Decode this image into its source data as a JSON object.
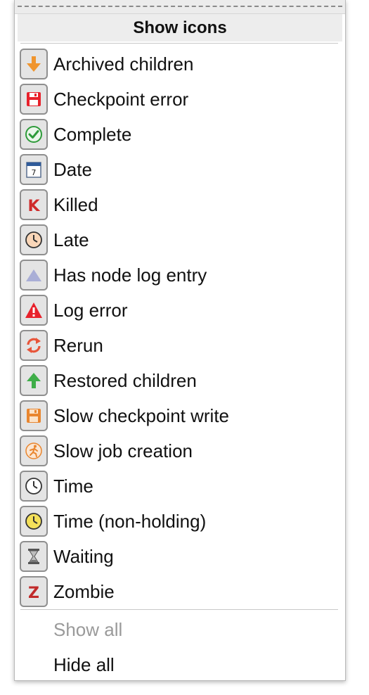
{
  "menu": {
    "header": "Show icons",
    "items": [
      {
        "label": "Archived children",
        "icon": "arrow-down-icon"
      },
      {
        "label": "Checkpoint error",
        "icon": "floppy-error-icon"
      },
      {
        "label": "Complete",
        "icon": "check-circle-icon"
      },
      {
        "label": "Date",
        "icon": "calendar-icon"
      },
      {
        "label": "Killed",
        "icon": "letter-k-icon"
      },
      {
        "label": "Late",
        "icon": "late-clock-icon"
      },
      {
        "label": "Has node log entry",
        "icon": "triangle-icon"
      },
      {
        "label": "Log error",
        "icon": "warning-icon"
      },
      {
        "label": "Rerun",
        "icon": "rerun-icon"
      },
      {
        "label": "Restored children",
        "icon": "arrow-up-icon"
      },
      {
        "label": "Slow checkpoint write",
        "icon": "floppy-slow-icon"
      },
      {
        "label": "Slow job creation",
        "icon": "running-figure-icon"
      },
      {
        "label": "Time",
        "icon": "clock-icon"
      },
      {
        "label": "Time (non-holding)",
        "icon": "clock-yellow-icon"
      },
      {
        "label": "Waiting",
        "icon": "hourglass-icon"
      },
      {
        "label": "Zombie",
        "icon": "letter-z-icon"
      }
    ],
    "show_all": "Show all",
    "hide_all": "Hide all",
    "calendar_day": "7",
    "killed_letter": "K",
    "zombie_letter": "Z"
  },
  "colors": {
    "archived_orange": "#f0952e",
    "error_red": "#e8212b",
    "complete_green": "#2e9b3a",
    "restored_green": "#3fae49",
    "rerun_orange": "#e8553a",
    "slow_orange": "#e9862f",
    "triangle_lavender": "#a9aed6",
    "killed_red": "#cf2b2b",
    "zombie_red": "#c12a2a"
  }
}
